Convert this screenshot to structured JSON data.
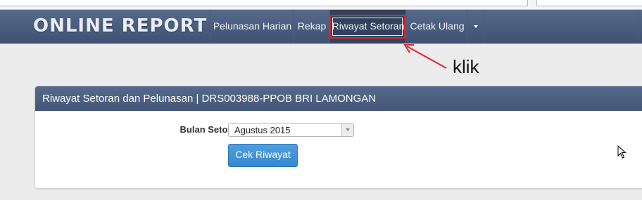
{
  "navbar": {
    "brand": "ONLINE REPORT",
    "items": [
      {
        "label": "Pelunasan Harian"
      },
      {
        "label": "Rekap"
      },
      {
        "label": "Riwayat Setoran"
      },
      {
        "label": "Cetak Ulang"
      }
    ]
  },
  "annotation": {
    "text": "klik",
    "color": "#e2232c"
  },
  "panel": {
    "title": "Riwayat Setoran dan Pelunasan | DRS003988-PPOB BRI LAMONGAN",
    "form": {
      "month_label": "Bulan Setoran:",
      "month_value": "Agustus 2015",
      "submit_label": "Cek Riwayat"
    }
  },
  "icons": [
    "chevron-down-icon",
    "mouse-cursor-icon",
    "arrow-annotation-icon"
  ],
  "colors": {
    "navbar": "#4a5d7e",
    "button": "#428bca",
    "highlight": "#e2232c"
  }
}
